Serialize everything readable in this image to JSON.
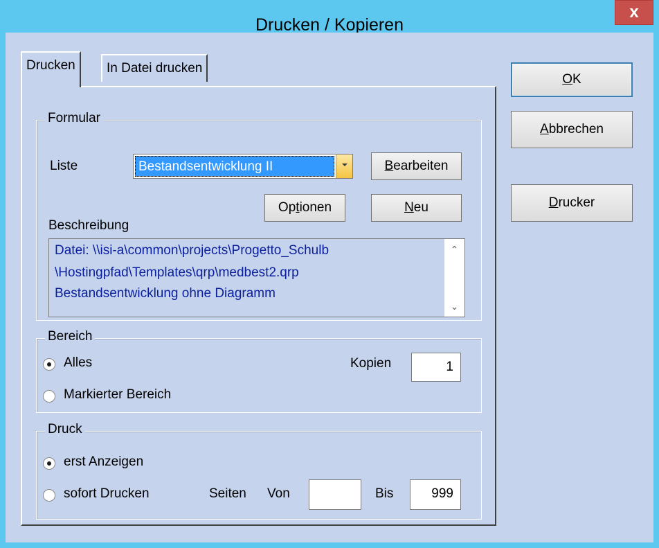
{
  "window": {
    "title": "Drucken / Kopieren",
    "close_label": "x"
  },
  "tabs": [
    {
      "label": "Drucken"
    },
    {
      "label": "In Datei drucken"
    }
  ],
  "formular": {
    "legend": "Formular",
    "liste_label": "Liste",
    "liste_value": "Bestandsentwicklung II",
    "bearbeiten": {
      "mnemonic": "B",
      "rest": "earbeiten"
    },
    "optionen": {
      "pre": "Op",
      "mnemonic": "t",
      "rest": "ionen"
    },
    "neu": {
      "mnemonic": "N",
      "rest": "eu"
    },
    "beschreibung_label": "Beschreibung",
    "beschreibung_lines": [
      "Datei: \\\\isi-a\\common\\projects\\Progetto_Schulb",
      "\\Hostingpfad\\Templates\\qrp\\medbest2.qrp",
      "Bestandsentwicklung ohne Diagramm"
    ]
  },
  "bereich": {
    "legend": "Bereich",
    "options": [
      {
        "label": "Alles",
        "checked": true
      },
      {
        "label": "Markierter Bereich",
        "checked": false
      }
    ],
    "kopien_label": "Kopien",
    "kopien_value": "1"
  },
  "druck": {
    "legend": "Druck",
    "options": [
      {
        "label": "erst Anzeigen",
        "checked": true
      },
      {
        "label": "sofort Drucken",
        "checked": false
      }
    ],
    "seiten_label": "Seiten",
    "von_label": "Von",
    "von_value": "",
    "bis_label": "Bis",
    "bis_value": "999"
  },
  "buttons": {
    "ok": {
      "mnemonic": "O",
      "rest": "K"
    },
    "abbrechen": {
      "mnemonic": "A",
      "rest": "bbrechen"
    },
    "drucker": {
      "mnemonic": "D",
      "rest": "rucker"
    }
  },
  "colors": {
    "titlebar": "#5cc8f0",
    "client": "#c5d3ec",
    "close": "#c7504c",
    "description_text": "#0a1f9c",
    "selection": "#3399ff"
  }
}
